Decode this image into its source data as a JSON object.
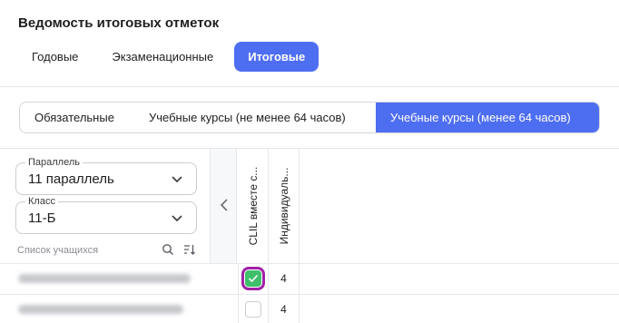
{
  "header": {
    "title": "Ведомость итоговых отметок",
    "tabs": [
      {
        "label": "Годовые"
      },
      {
        "label": "Экзаменационные"
      },
      {
        "label": "Итоговые"
      }
    ]
  },
  "segments": [
    {
      "label": "Обязательные"
    },
    {
      "label": "Учебные курсы (не менее 64 часов)"
    },
    {
      "label": "Учебные курсы (менее 64 часов)"
    }
  ],
  "filters": {
    "parallel": {
      "label": "Параллель",
      "value": "11 параллель"
    },
    "class": {
      "label": "Класс",
      "value": "11-Б"
    },
    "students_label": "Список учащихся"
  },
  "columns": [
    {
      "label": "CLIL вместе с..."
    },
    {
      "label": "Индивидуаль..."
    }
  ],
  "rows": [
    {
      "clil_checked": true,
      "individual": "4"
    },
    {
      "clil_checked": false,
      "individual": "4"
    }
  ],
  "colors": {
    "accent": "#4e6ef2",
    "check": "#3fbf6a",
    "highlight": "#a020a8"
  },
  "icons": [
    "chevron-down-icon",
    "chevron-left-icon",
    "search-icon",
    "sort-icon",
    "check-icon"
  ]
}
